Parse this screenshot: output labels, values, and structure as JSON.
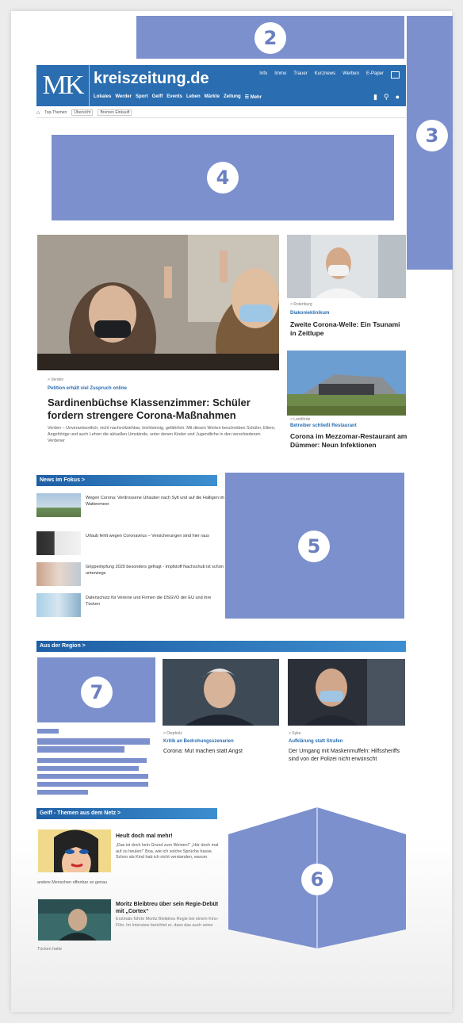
{
  "header": {
    "logo": "MK",
    "site_name": "kreiszeitung.de",
    "top_nav": [
      "Info",
      "Immo",
      "Trauer",
      "Kurznews",
      "Werben",
      "E-Paper"
    ],
    "main_nav": [
      "Lokales",
      "Werder",
      "Sport",
      "Geiff",
      "Events",
      "Leben",
      "Märkte",
      "Zeitung",
      "☰ Mehr"
    ],
    "breadcrumbs": [
      "Top-Themen",
      "Übersicht",
      "Bremen Einkauft"
    ]
  },
  "placeholders": {
    "p2": "2",
    "p3": "3",
    "p4": "4",
    "p5": "5",
    "p6": "6",
    "p7": "7"
  },
  "hero": {
    "location": "> Verden",
    "kicker": "Petition erhält viel Zuspruch online",
    "title": "Sardinenbüchse Klassenzimmer: Schüler fordern strengere Corona-Maßnahmen",
    "teaser": "Verden – Unverantwortlich, nicht nachvollziehbar, leichtsinnig, gefährlich. Mit diesen Worten beschreiben Schüler, Eltern, Angehörige und auch Lehrer die aktuellen Umstände, unter denen Kinder und Jugendliche in den verschiedenen Verdener"
  },
  "side_articles": [
    {
      "location": "> Rotenburg",
      "kicker": "Diakonieklinikum",
      "title": "Zweite Corona-Welle: Ein Tsunami in Zeitlupe"
    },
    {
      "location": "> Lemförde",
      "kicker": "Betreiber schließt Restaurant",
      "title": "Corona im Mezzomar-Restaurant am Dümmer: Neun Infektionen"
    }
  ],
  "news_focus": {
    "heading": "News im Fokus >",
    "items": [
      "Wegen Corona: Verdrossene Urlauber nach Sylt und auf die Halligen im Wattenmeer",
      "Urlaub fehlt wegen Coronavirus – Versicherungen sind hier raus",
      "Grippeimpfung 2020 besonders gefragt - Impfstoff Nachschub ist schon unterwegs",
      "Datenschutz für Vereine und Firmen die DSGVO der EU und ihre Tücken"
    ]
  },
  "region": {
    "heading": "Aus der Region >",
    "articles": [
      {
        "location": "> Diepholz",
        "kicker": "Kritik an Bedrohungsszenarien",
        "title": "Corona: Mut machen statt Angst"
      },
      {
        "location": "> Syke",
        "kicker": "Aufklärung statt Strafen",
        "title": "Der Umgang mit Maskenmuffeln: Hilfssheriffs sind von der Polizei nicht erwünscht"
      }
    ]
  },
  "netz": {
    "heading": "Geiff - Themen aus dem Netz >",
    "items": [
      {
        "title": "Heult doch mal mehr!",
        "text": "„Das ist doch kein Grund zum Weinen!“ „Hör doch mal auf zu heulen!“ Boa, wie ich solche Sprüche hasse. Schon als Kind hab ich nicht verstanden, warum",
        "tail": "andere Menschen offenbar so genau"
      },
      {
        "title": "Moritz Bleibtreu über sein Regie-Debüt mit „Cortex“",
        "text": "Erstmals führte Moritz Bleibtreu Regie bei einem Kino-Film. Im Interview berichtet er, dass das auch seine",
        "tail": "Tücken hatte"
      }
    ]
  },
  "colors": {
    "brand_blue": "#2a6db0",
    "placeholder": "#7b90cd",
    "background": "#ececec"
  }
}
